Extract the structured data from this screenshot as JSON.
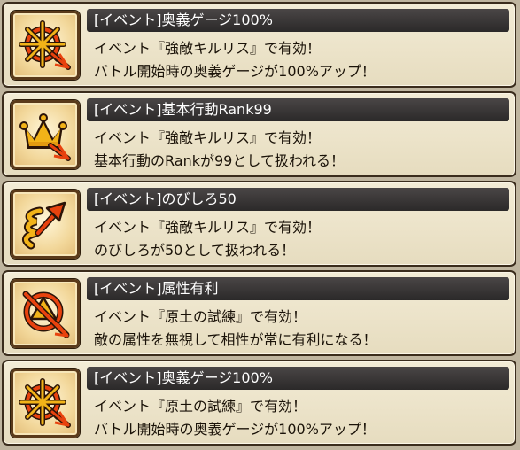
{
  "colors": {
    "background": "#bfb59f",
    "card_bg": "#efe7cf",
    "title_bar": "#3a3737",
    "icon_accent": "#e8420e",
    "icon_gold": "#f2b318"
  },
  "skills": [
    {
      "icon": "ougi-gauge-icon",
      "title": "[イベント]奥義ゲージ100%",
      "line1": "イベント『強敵キルリス』で有効！",
      "line2": "バトル開始時の奥義ゲージが100%アップ！"
    },
    {
      "icon": "crown-rank-icon",
      "title": "[イベント]基本行動Rank99",
      "line1": "イベント『強敵キルリス』で有効！",
      "line2": "基本行動のRankが99として扱われる！"
    },
    {
      "icon": "spring-arrow-icon",
      "title": "[イベント]のびしろ50",
      "line1": "イベント『強敵キルリス』で有効！",
      "line2": "のびしろが50として扱われる！"
    },
    {
      "icon": "attribute-advantage-icon",
      "title": "[イベント]属性有利",
      "line1": "イベント『原土の試練』で有効！",
      "line2": "敵の属性を無視して相性が常に有利になる！"
    },
    {
      "icon": "ougi-gauge-icon",
      "title": "[イベント]奥義ゲージ100%",
      "line1": "イベント『原土の試練』で有効！",
      "line2": "バトル開始時の奥義ゲージが100%アップ！"
    }
  ]
}
